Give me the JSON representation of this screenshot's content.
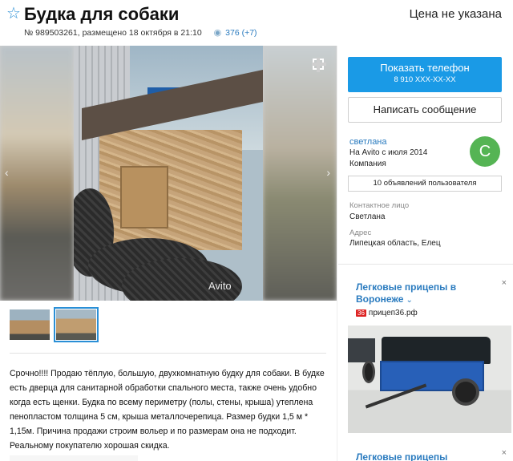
{
  "listing": {
    "title": "Будка для собаки",
    "price": "Цена не указана",
    "meta": "№ 989503261, размещено 18 октября в 21:10",
    "views": "376 (+7)",
    "description": "Срочно!!!! Продаю тёплую, большую, двухкомнатную будку для собаки. В будке есть дверца для санитарной обработки спального места, также очень удобно когда есть щенки. Будка по всему периметру (полы, стены, крыша) утеплена пенопластом толщина 5 см, крыша металлочерепица. Размер будки 1,5 м * 1,15м. Причина продажи строим вольер и по размерам она не подходит. Реальному покупателю хорошая скидка."
  },
  "gallery": {
    "watermark": "Avito",
    "prev": "‹",
    "next": "›",
    "selected_thumb": 2
  },
  "icons": {
    "favorite": "star-icon",
    "views": "eye-icon",
    "fullscreen": "fullscreen-icon",
    "ad_close": "close-icon"
  },
  "seller": {
    "phone_button": "Показать телефон",
    "phone_masked": "8 910 XXX-XX-XX",
    "message_button": "Написать сообщение",
    "name": "светлана",
    "since": "На Avito с июля 2014",
    "type": "Компания",
    "avatar_letter": "С",
    "ads_button": "10 объявлений пользователя",
    "contact_label": "Контактное лицо",
    "contact_value": "Светлана",
    "address_label": "Адрес",
    "address_value": "Липецкая область, Елец"
  },
  "ads": {
    "ad1_title": "Легковые прицепы в Воронеже",
    "ad1_badge": "36",
    "ad1_site": "прицеп36.рф",
    "ad2_title": "Легковые прицепы",
    "close": "×"
  },
  "colors": {
    "accent": "#1a9ae6",
    "link": "#2a7bbf",
    "avatar": "#55b454"
  }
}
